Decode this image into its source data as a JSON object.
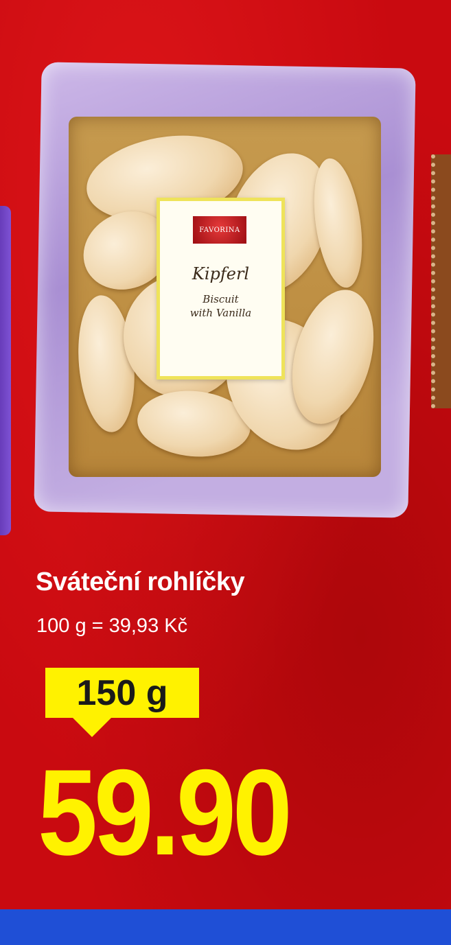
{
  "product": {
    "name": "Sváteční rohlíčky",
    "unit_price": "100 g = 39,93 Kč",
    "weight": "150 g",
    "price": "59.90"
  },
  "package_label": {
    "brand": "FAVORINA",
    "title": "Kipferl",
    "subtitle_line1": "Biscuit",
    "subtitle_line2": "with Vanilla"
  },
  "colors": {
    "background": "#c90a10",
    "accent_yellow": "#fff200",
    "bottom_bar": "#1f4fd6"
  }
}
